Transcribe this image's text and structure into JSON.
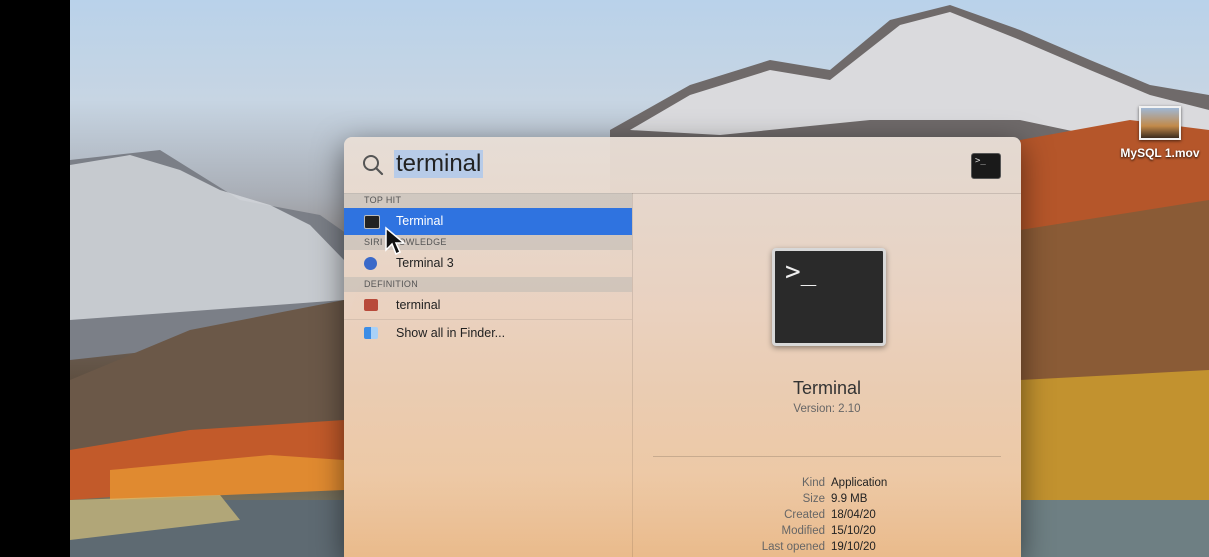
{
  "spotlight": {
    "query": "terminal",
    "sections": [
      {
        "header": "TOP HIT",
        "items": [
          {
            "label": "Terminal",
            "icon": "terminal-icon",
            "selected": true
          }
        ]
      },
      {
        "header": "SIRI KNOWLEDGE",
        "items": [
          {
            "label": "Terminal 3",
            "icon": "siri-icon"
          }
        ]
      },
      {
        "header": "DEFINITION",
        "items": [
          {
            "label": "terminal",
            "icon": "dictionary-icon"
          }
        ]
      }
    ],
    "show_all": "Show all in Finder...",
    "preview": {
      "prompt": ">_",
      "name": "Terminal",
      "version": "Version: 2.10",
      "meta": [
        {
          "key": "Kind",
          "value": "Application"
        },
        {
          "key": "Size",
          "value": "9.9 MB"
        },
        {
          "key": "Created",
          "value": "18/04/20"
        },
        {
          "key": "Modified",
          "value": "15/10/20"
        },
        {
          "key": "Last opened",
          "value": "19/10/20"
        }
      ]
    }
  },
  "desktop": {
    "file_label": "MySQL 1.mov"
  },
  "colors": {
    "selection": "#2f73e0",
    "search_highlight": "#b7cbe8"
  }
}
